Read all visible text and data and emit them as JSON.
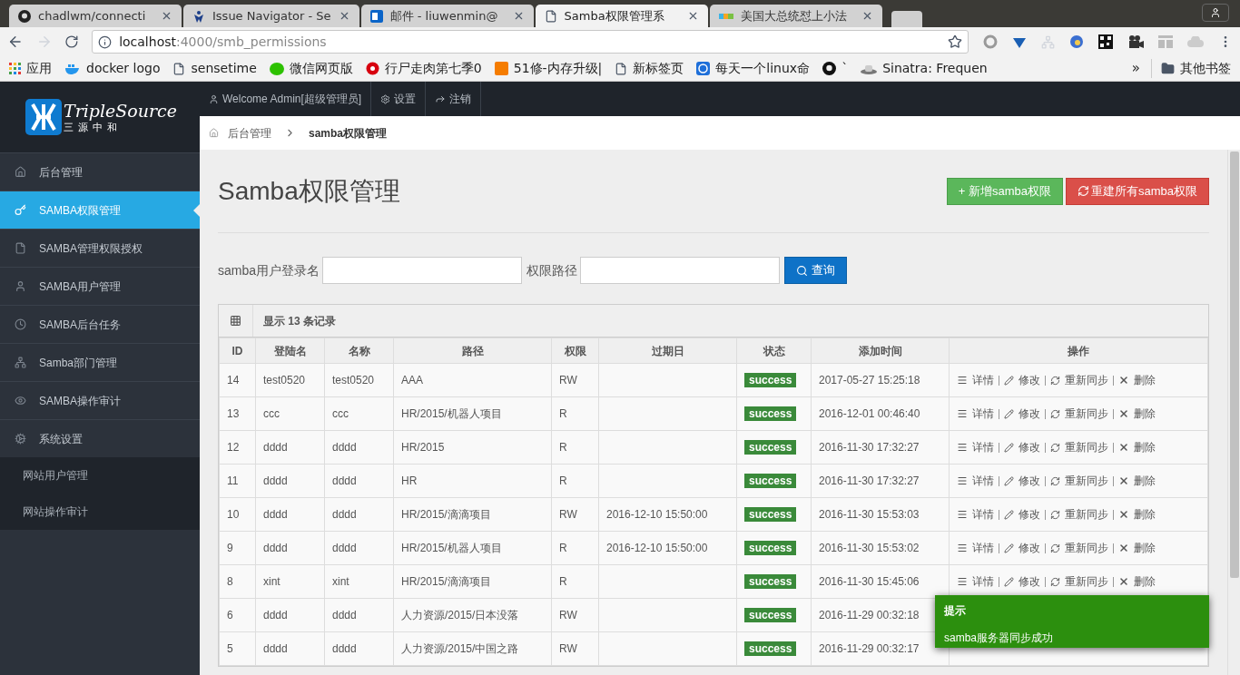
{
  "browser": {
    "tabs": [
      {
        "title": "chadlwm/connecti",
        "kind": "github",
        "selected": false
      },
      {
        "title": "Issue Navigator - Se",
        "kind": "jira",
        "selected": false
      },
      {
        "title": "邮件 - liuwenmin@",
        "kind": "mail",
        "selected": false
      },
      {
        "title": "Samba权限管理系",
        "kind": "page",
        "selected": true
      },
      {
        "title": "美国大总统怼上小法",
        "kind": "news",
        "selected": false
      }
    ],
    "address": {
      "host": "localhost",
      "path": ":4000/smb_permissions"
    },
    "bookmarks": [
      {
        "label": "应用",
        "kind": "apps"
      },
      {
        "label": "docker logo",
        "kind": "docker"
      },
      {
        "label": "sensetime",
        "kind": "page"
      },
      {
        "label": "微信网页版",
        "kind": "wechat"
      },
      {
        "label": "行尸走肉第七季0",
        "kind": "flower"
      },
      {
        "label": "51修-内存升级|",
        "kind": "orange"
      },
      {
        "label": "新标签页",
        "kind": "page"
      },
      {
        "label": "每天一个linux命",
        "kind": "blue"
      },
      {
        "label": "`",
        "kind": "github"
      },
      {
        "label": "Sinatra: Frequen",
        "kind": "hat"
      }
    ],
    "bookmarks_more": "»",
    "other_bookmarks": "其他书签"
  },
  "topbar": {
    "welcome": "Welcome Admin[超级管理员]",
    "settings": "设置",
    "logout": "注销"
  },
  "logo": {
    "name": "TripleSource",
    "subtitle": "三源中和"
  },
  "sidebar": {
    "items": [
      {
        "label": "后台管理",
        "selected": false
      },
      {
        "label": "SAMBA权限管理",
        "selected": true
      },
      {
        "label": "SAMBA管理权限授权",
        "selected": false
      },
      {
        "label": "SAMBA用户管理",
        "selected": false
      },
      {
        "label": "SAMBA后台任务",
        "selected": false
      },
      {
        "label": "Samba部门管理",
        "selected": false
      },
      {
        "label": "SAMBA操作审计",
        "selected": false
      },
      {
        "label": "系统设置",
        "selected": false,
        "children": [
          {
            "label": "网站用户管理"
          },
          {
            "label": "网站操作审计"
          }
        ]
      }
    ]
  },
  "breadcrumb": [
    "后台管理",
    "samba权限管理"
  ],
  "page_title": "Samba权限管理",
  "buttons": {
    "add": "+ 新增samba权限",
    "rebuild": "重建所有samba权限"
  },
  "search": {
    "fields": [
      {
        "label": "samba用户登录名"
      },
      {
        "label": "权限路径"
      }
    ],
    "submit": "查询"
  },
  "table": {
    "caption": "显示 13 条记录",
    "columns": [
      "ID",
      "登陆名",
      "名称",
      "路径",
      "权限",
      "过期日",
      "状态",
      "添加时间",
      "操作"
    ],
    "rows": [
      {
        "cells": [
          "14",
          "test0520",
          "test0520",
          "AAA",
          "RW",
          "",
          "success",
          "2017-05-27 15:25:18"
        ],
        "actions": [
          "详情",
          "修改",
          "重新同步",
          "删除"
        ]
      },
      {
        "cells": [
          "13",
          "ccc",
          "ccc",
          "HR/2015/机器人项目",
          "R",
          "",
          "success",
          "2016-12-01 00:46:40"
        ],
        "actions": [
          "详情",
          "修改",
          "重新同步",
          "删除"
        ]
      },
      {
        "cells": [
          "12",
          "dddd",
          "dddd",
          "HR/2015",
          "R",
          "",
          "success",
          "2016-11-30 17:32:27"
        ],
        "actions": [
          "详情",
          "修改",
          "重新同步",
          "删除"
        ]
      },
      {
        "cells": [
          "11",
          "dddd",
          "dddd",
          "HR",
          "R",
          "",
          "success",
          "2016-11-30 17:32:27"
        ],
        "actions": [
          "详情",
          "修改",
          "重新同步",
          "删除"
        ]
      },
      {
        "cells": [
          "10",
          "dddd",
          "dddd",
          "HR/2015/滴滴项目",
          "RW",
          "2016-12-10 15:50:00",
          "success",
          "2016-11-30 15:53:03"
        ],
        "actions": [
          "详情",
          "修改",
          "重新同步",
          "删除"
        ]
      },
      {
        "cells": [
          "9",
          "dddd",
          "dddd",
          "HR/2015/机器人项目",
          "R",
          "2016-12-10 15:50:00",
          "success",
          "2016-11-30 15:53:02"
        ],
        "actions": [
          "详情",
          "修改",
          "重新同步",
          "删除"
        ]
      },
      {
        "cells": [
          "8",
          "xint",
          "xint",
          "HR/2015/滴滴项目",
          "R",
          "",
          "success",
          "2016-11-30 15:45:06"
        ],
        "actions": [
          "详情",
          "修改",
          "重新同步",
          "删除"
        ]
      },
      {
        "cells": [
          "6",
          "dddd",
          "dddd",
          "人力资源/2015/日本没落",
          "RW",
          "",
          "success",
          "2016-11-29 00:32:18"
        ]
      },
      {
        "cells": [
          "5",
          "dddd",
          "dddd",
          "人力资源/2015/中国之路",
          "RW",
          "",
          "success",
          "2016-11-29 00:32:17"
        ]
      }
    ]
  },
  "toast": {
    "title": "提示",
    "message": "samba服务器同步成功"
  }
}
